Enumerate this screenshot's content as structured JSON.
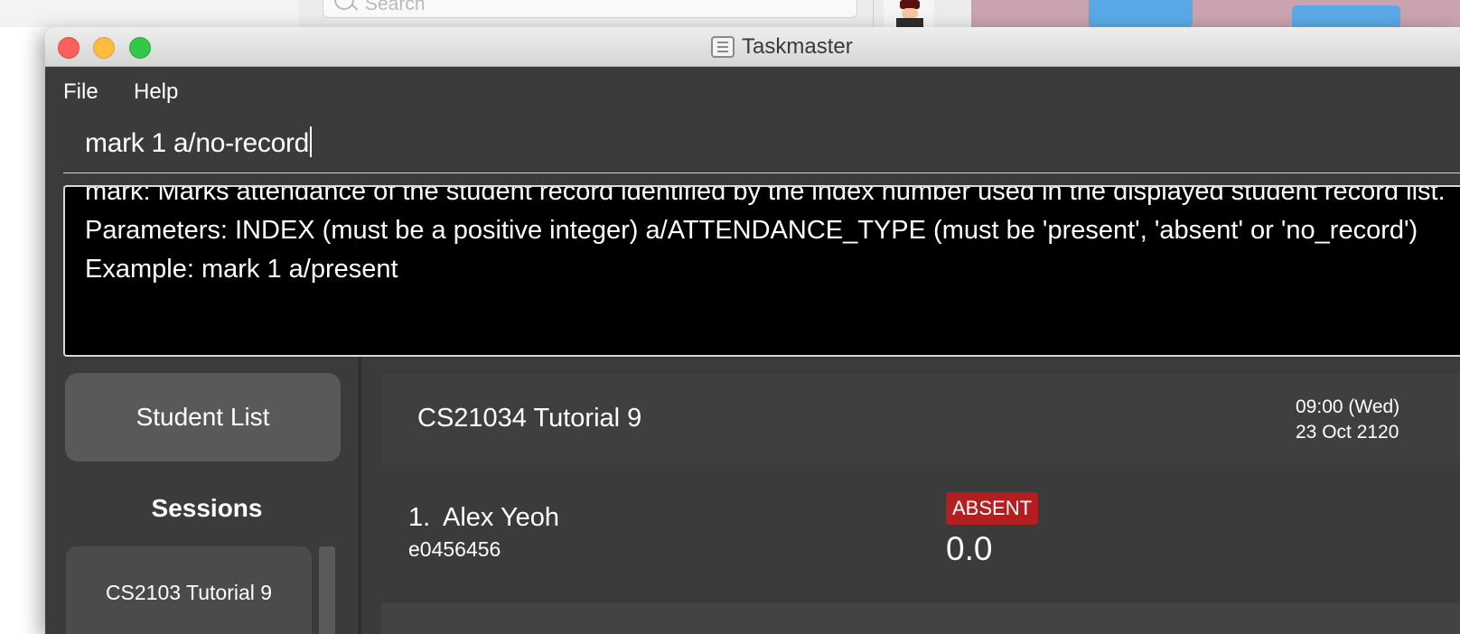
{
  "background": {
    "search_placeholder": "Search"
  },
  "window": {
    "title": "Taskmaster"
  },
  "menu": {
    "file": "File",
    "help": "Help"
  },
  "command_input": {
    "value": "mark 1 a/no-record"
  },
  "result_display": {
    "text": "mark: Marks attendance of the student record identified by the index number used in the displayed student record list.\nParameters: INDEX (must be a positive integer) a/ATTENDANCE_TYPE (must be 'present', 'absent' or 'no_record')\nExample: mark 1 a/present"
  },
  "sidebar": {
    "student_list_button": "Student List",
    "sessions_label": "Sessions",
    "sessions": [
      {
        "label": "CS2103 Tutorial 9"
      }
    ]
  },
  "session_view": {
    "title": "CS21034 Tutorial 9",
    "time": "09:00 (Wed)",
    "date": "23 Oct 2120",
    "records": [
      {
        "index": "1.",
        "name": "Alex Yeoh",
        "student_id": "e0456456",
        "attendance": "ABSENT",
        "score": "0.0"
      }
    ]
  },
  "colors": {
    "absent_badge": "#b31e1e",
    "window_bg": "#3b3b3b",
    "result_bg": "#000000"
  }
}
